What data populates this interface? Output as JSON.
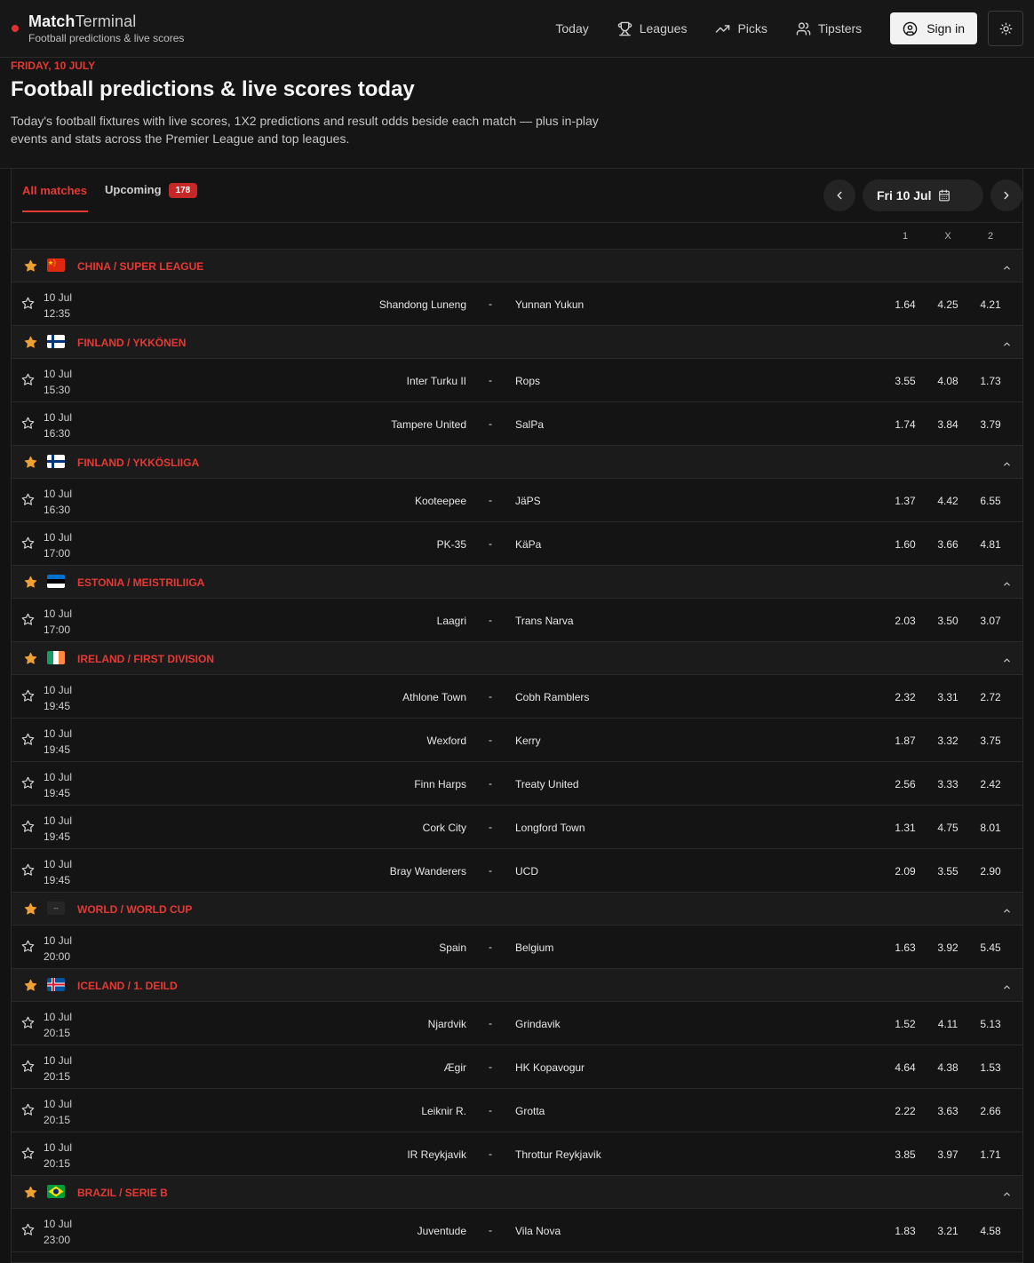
{
  "header": {
    "brand_bold": "Match",
    "brand_light": "Terminal",
    "subtitle": "Football predictions & live scores",
    "nav": [
      {
        "label": "Today",
        "icon": "none"
      },
      {
        "label": "Leagues",
        "icon": "trophy-icon"
      },
      {
        "label": "Picks",
        "icon": "trending-up-icon"
      },
      {
        "label": "Tipsters",
        "icon": "users-icon"
      }
    ],
    "sign_in": "Sign in"
  },
  "hero": {
    "date": "FRIDAY, 10 JULY",
    "title": "Football predictions & live scores today",
    "description": "Today's football fixtures with live scores, 1X2 predictions and result odds beside each match — plus in-play events and stats across the Premier League and top leagues."
  },
  "tabs": {
    "all": "All matches",
    "upcoming": "Upcoming",
    "upcoming_count": "178",
    "date": "Fri 10 Jul"
  },
  "odds_headers": [
    "1",
    "X",
    "2"
  ],
  "colors": {
    "accent": "#e53935",
    "star": "#f0a030",
    "background": "#121212"
  },
  "leagues": [
    {
      "name": "CHINA / SUPER LEAGUE",
      "flag": "cn",
      "matches": [
        {
          "date": "10 Jul",
          "time": "12:35",
          "home": "Shandong Luneng",
          "away": "Yunnan Yukun",
          "o1": "1.64",
          "ox": "4.25",
          "o2": "4.21"
        }
      ]
    },
    {
      "name": "FINLAND / YKKÖNEN",
      "flag": "fi",
      "matches": [
        {
          "date": "10 Jul",
          "time": "15:30",
          "home": "Inter Turku II",
          "away": "Rops",
          "o1": "3.55",
          "ox": "4.08",
          "o2": "1.73"
        },
        {
          "date": "10 Jul",
          "time": "16:30",
          "home": "Tampere United",
          "away": "SalPa",
          "o1": "1.74",
          "ox": "3.84",
          "o2": "3.79"
        }
      ]
    },
    {
      "name": "FINLAND / YKKÖSLIIGA",
      "flag": "fi",
      "matches": [
        {
          "date": "10 Jul",
          "time": "16:30",
          "home": "Kooteepee",
          "away": "JäPS",
          "o1": "1.37",
          "ox": "4.42",
          "o2": "6.55"
        },
        {
          "date": "10 Jul",
          "time": "17:00",
          "home": "PK-35",
          "away": "KäPa",
          "o1": "1.60",
          "ox": "3.66",
          "o2": "4.81"
        }
      ]
    },
    {
      "name": "ESTONIA / MEISTRILIIGA",
      "flag": "ee",
      "matches": [
        {
          "date": "10 Jul",
          "time": "17:00",
          "home": "Laagri",
          "away": "Trans Narva",
          "o1": "2.03",
          "ox": "3.50",
          "o2": "3.07"
        }
      ]
    },
    {
      "name": "IRELAND / FIRST DIVISION",
      "flag": "ie",
      "matches": [
        {
          "date": "10 Jul",
          "time": "19:45",
          "home": "Athlone Town",
          "away": "Cobh Ramblers",
          "o1": "2.32",
          "ox": "3.31",
          "o2": "2.72"
        },
        {
          "date": "10 Jul",
          "time": "19:45",
          "home": "Wexford",
          "away": "Kerry",
          "o1": "1.87",
          "ox": "3.32",
          "o2": "3.75"
        },
        {
          "date": "10 Jul",
          "time": "19:45",
          "home": "Finn Harps",
          "away": "Treaty United",
          "o1": "2.56",
          "ox": "3.33",
          "o2": "2.42"
        },
        {
          "date": "10 Jul",
          "time": "19:45",
          "home": "Cork City",
          "away": "Longford Town",
          "o1": "1.31",
          "ox": "4.75",
          "o2": "8.01"
        },
        {
          "date": "10 Jul",
          "time": "19:45",
          "home": "Bray Wanderers",
          "away": "UCD",
          "o1": "2.09",
          "ox": "3.55",
          "o2": "2.90"
        }
      ]
    },
    {
      "name": "WORLD / WORLD CUP",
      "flag": "world",
      "flag_text": "--",
      "matches": [
        {
          "date": "10 Jul",
          "time": "20:00",
          "home": "Spain",
          "away": "Belgium",
          "o1": "1.63",
          "ox": "3.92",
          "o2": "5.45"
        }
      ]
    },
    {
      "name": "ICELAND / 1. DEILD",
      "flag": "is",
      "matches": [
        {
          "date": "10 Jul",
          "time": "20:15",
          "home": "Njardvik",
          "away": "Grindavik",
          "o1": "1.52",
          "ox": "4.11",
          "o2": "5.13"
        },
        {
          "date": "10 Jul",
          "time": "20:15",
          "home": "Ægir",
          "away": "HK Kopavogur",
          "o1": "4.64",
          "ox": "4.38",
          "o2": "1.53"
        },
        {
          "date": "10 Jul",
          "time": "20:15",
          "home": "Leiknir R.",
          "away": "Grotta",
          "o1": "2.22",
          "ox": "3.63",
          "o2": "2.66"
        },
        {
          "date": "10 Jul",
          "time": "20:15",
          "home": "IR Reykjavik",
          "away": "Throttur Reykjavik",
          "o1": "3.85",
          "ox": "3.97",
          "o2": "1.71"
        }
      ]
    },
    {
      "name": "BRAZIL / SERIE B",
      "flag": "br",
      "matches": [
        {
          "date": "10 Jul",
          "time": "23:00",
          "home": "Juventude",
          "away": "Vila Nova",
          "o1": "1.83",
          "ox": "3.21",
          "o2": "4.58"
        }
      ]
    }
  ]
}
